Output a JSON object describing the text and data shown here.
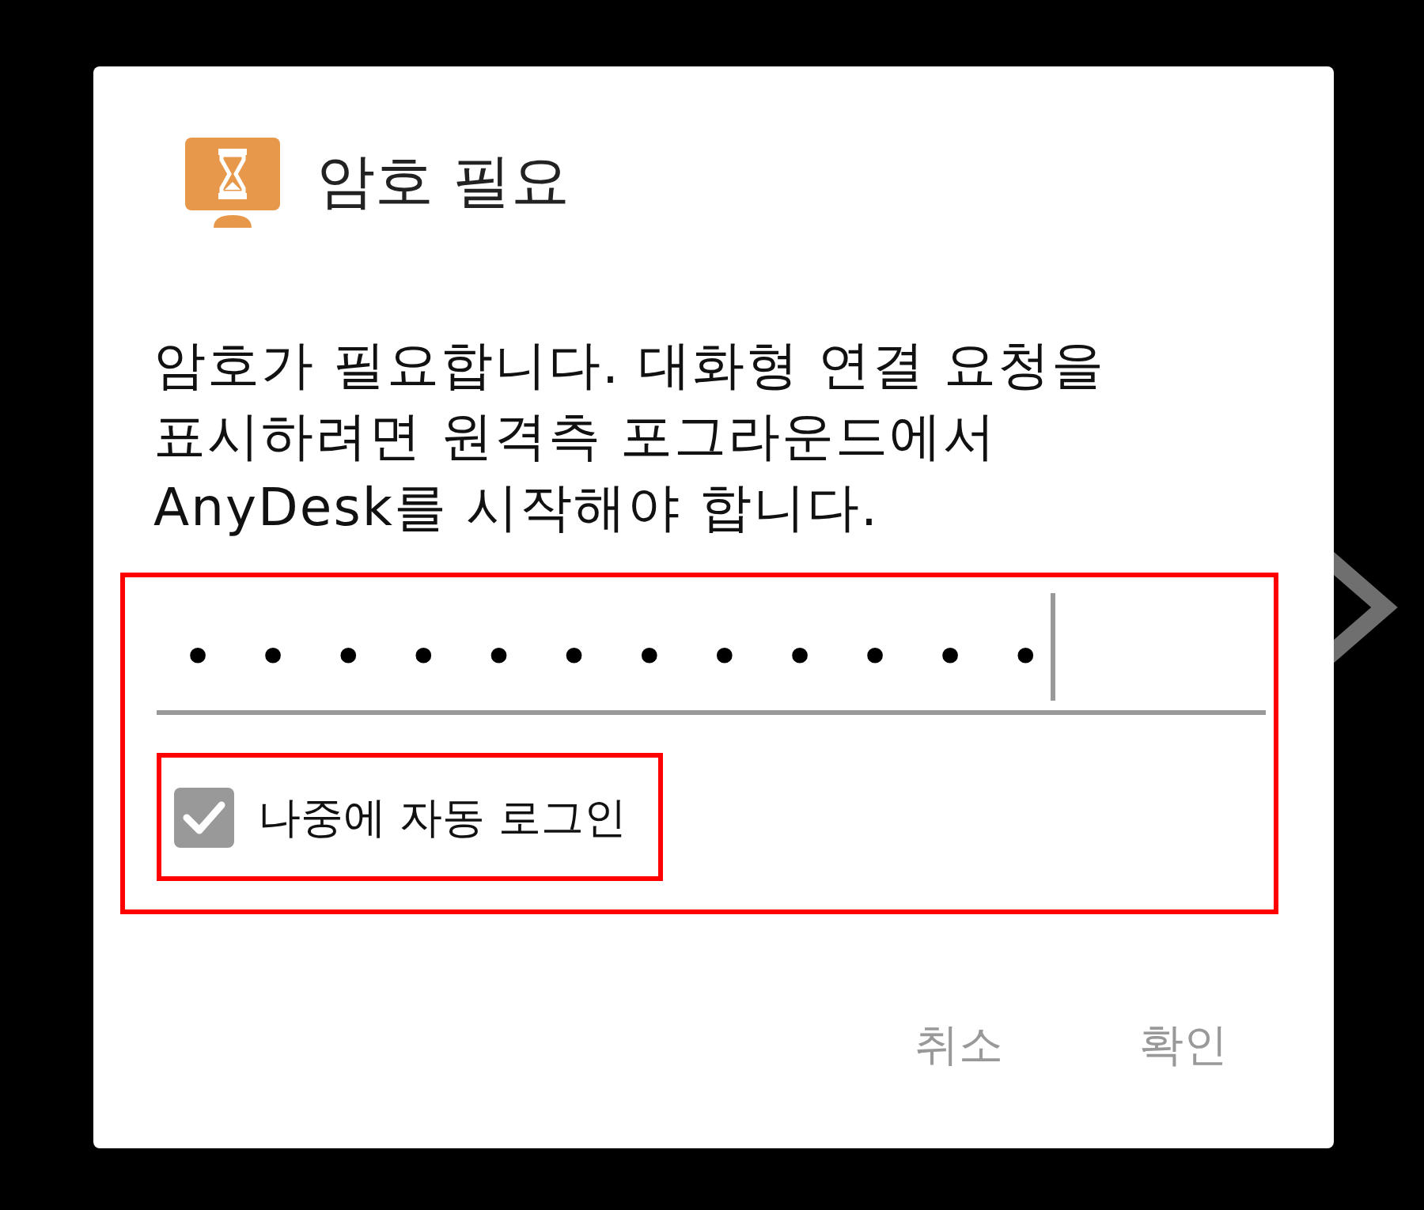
{
  "dialog": {
    "title": "암호 필요",
    "message_lines": [
      "암호가 필요합니다. 대화형 연결 요청을",
      "표시하려면 원격측 포그라운드에서",
      "AnyDesk를 시작해야 합니다."
    ],
    "input_section": {
      "highlighted": true,
      "password": {
        "value": "••••••••••••",
        "focused": true
      },
      "auto_login": {
        "label": "나중에 자동 로그인",
        "checked": true,
        "highlighted": true
      }
    },
    "buttons": [
      {
        "label": "취소"
      },
      {
        "label": "확인"
      }
    ]
  }
}
